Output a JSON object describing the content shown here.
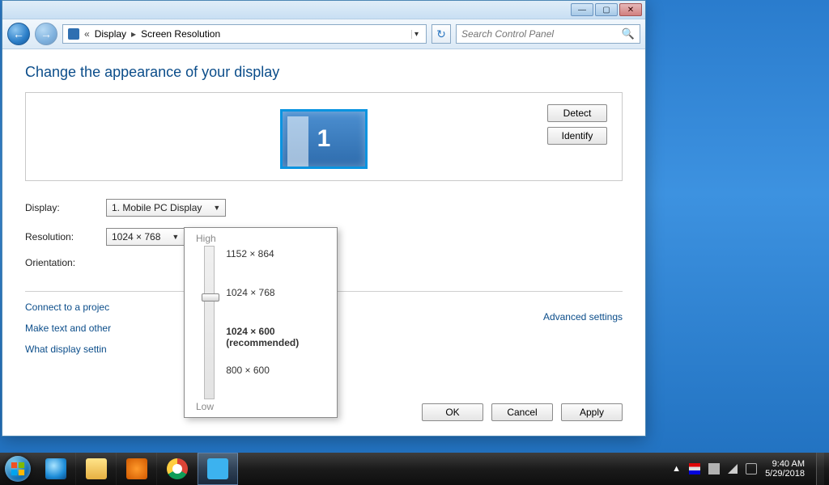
{
  "titlebar": {
    "min": "—",
    "max": "▢",
    "close": "✕"
  },
  "nav": {
    "back": "←",
    "fwd": "→",
    "path_prefix": "«",
    "path_root": "Display",
    "path_leaf": "Screen Resolution"
  },
  "search": {
    "placeholder": "Search Control Panel"
  },
  "heading": "Change the appearance of your display",
  "preview": {
    "monitor_number": "1",
    "detect": "Detect",
    "identify": "Identify"
  },
  "form": {
    "display_label": "Display:",
    "display_value": "1. Mobile PC Display",
    "resolution_label": "Resolution:",
    "resolution_value": "1024 × 768",
    "orientation_label": "Orientation:"
  },
  "advanced_link": "Advanced settings",
  "links": {
    "projector": "Connect to a projec",
    "textsize": "Make text and other",
    "whatsettings": "What display settin"
  },
  "buttons": {
    "ok": "OK",
    "cancel": "Cancel",
    "apply": "Apply"
  },
  "res_popup": {
    "high": "High",
    "low": "Low",
    "ticks": [
      "1152 × 864",
      "1024 × 768",
      "1024 × 600 (recommended)",
      "800 × 600"
    ]
  },
  "taskbar": {
    "time": "9:40 AM",
    "date": "5/29/2018",
    "tray_up": "▲"
  }
}
